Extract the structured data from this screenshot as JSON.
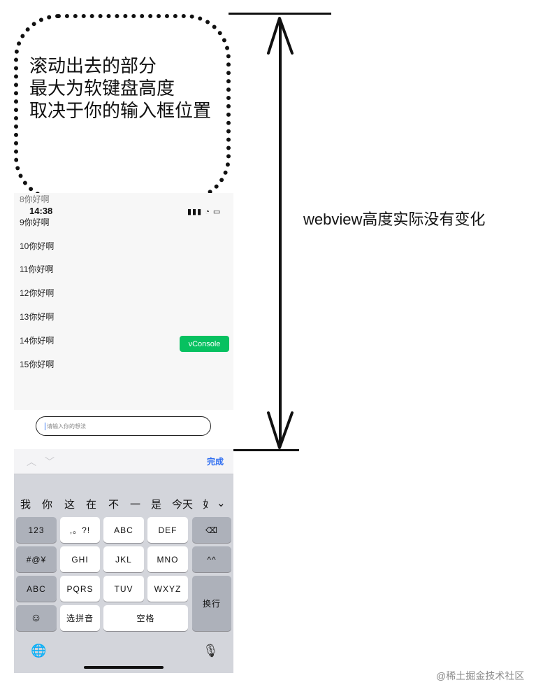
{
  "annotation": {
    "lines": [
      "滚动出去的部分",
      "最大为软键盘高度",
      "取决于你的输入框位置"
    ],
    "measure_label": "webview高度实际没有变化"
  },
  "phone": {
    "faded_line": "8你好啊",
    "time": "14:38",
    "status_icons": "▮▮▮ ◔ ▭",
    "messages": [
      "9你好啊",
      "10你好啊",
      "11你好啊",
      "12你好啊",
      "13你好啊",
      "14你好啊",
      "15你好啊"
    ],
    "vconsole_label": "vConsole",
    "input_placeholder": "请输入你的想法"
  },
  "keyboard": {
    "toolbar": {
      "done_label": "完成",
      "chevron_up": "︿",
      "chevron_down": "﹀"
    },
    "candidates": [
      "我",
      "你",
      "这",
      "在",
      "不",
      "一",
      "是",
      "今天",
      "如"
    ],
    "candidates_more": "⌄",
    "rows": [
      [
        "123",
        ",。?!",
        "ABC",
        "DEF",
        "⌫"
      ],
      [
        "#@¥",
        "GHI",
        "JKL",
        "MNO",
        "^^"
      ],
      [
        "ABC",
        "PQRS",
        "TUV",
        "WXYZ",
        "换行"
      ],
      [
        "☺",
        "选拼音",
        "空格"
      ]
    ],
    "globe": "🌐",
    "mic": "🎙"
  },
  "watermark": "@稀土掘金技术社区"
}
